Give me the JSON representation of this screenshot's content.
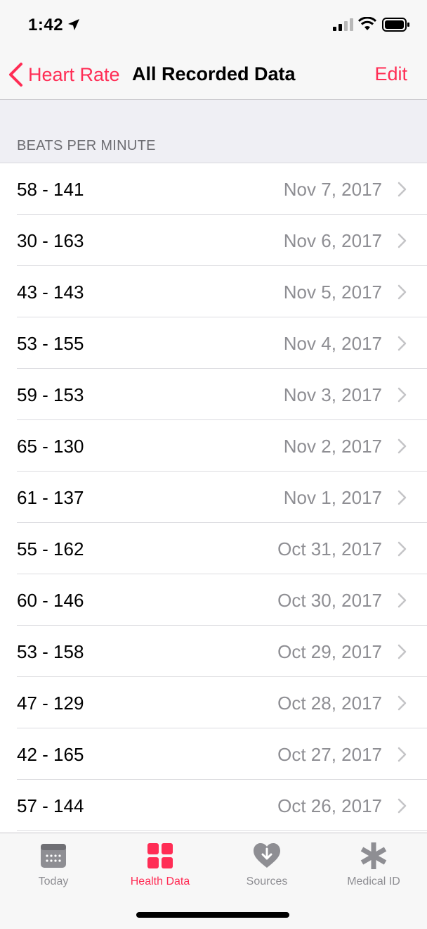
{
  "status_bar": {
    "time": "1:42"
  },
  "nav": {
    "back_label": "Heart Rate",
    "title": "All Recorded Data",
    "edit_label": "Edit"
  },
  "section": {
    "header": "BEATS PER MINUTE"
  },
  "rows": [
    {
      "value": "58 - 141",
      "date": "Nov 7, 2017"
    },
    {
      "value": "30 - 163",
      "date": "Nov 6, 2017"
    },
    {
      "value": "43 - 143",
      "date": "Nov 5, 2017"
    },
    {
      "value": "53 - 155",
      "date": "Nov 4, 2017"
    },
    {
      "value": "59 - 153",
      "date": "Nov 3, 2017"
    },
    {
      "value": "65 - 130",
      "date": "Nov 2, 2017"
    },
    {
      "value": "61 - 137",
      "date": "Nov 1, 2017"
    },
    {
      "value": "55 - 162",
      "date": "Oct 31, 2017"
    },
    {
      "value": "60 - 146",
      "date": "Oct 30, 2017"
    },
    {
      "value": "53 - 158",
      "date": "Oct 29, 2017"
    },
    {
      "value": "47 - 129",
      "date": "Oct 28, 2017"
    },
    {
      "value": "42 - 165",
      "date": "Oct 27, 2017"
    },
    {
      "value": "57 - 144",
      "date": "Oct 26, 2017"
    }
  ],
  "tabs": [
    {
      "label": "Today",
      "icon": "calendar-icon",
      "active": false
    },
    {
      "label": "Health Data",
      "icon": "grid-icon",
      "active": true
    },
    {
      "label": "Sources",
      "icon": "heart-download-icon",
      "active": false
    },
    {
      "label": "Medical ID",
      "icon": "asterisk-icon",
      "active": false
    }
  ],
  "colors": {
    "accent": "#ff2d55",
    "secondary_text": "#8e8e93",
    "group_bg": "#efeff4"
  }
}
